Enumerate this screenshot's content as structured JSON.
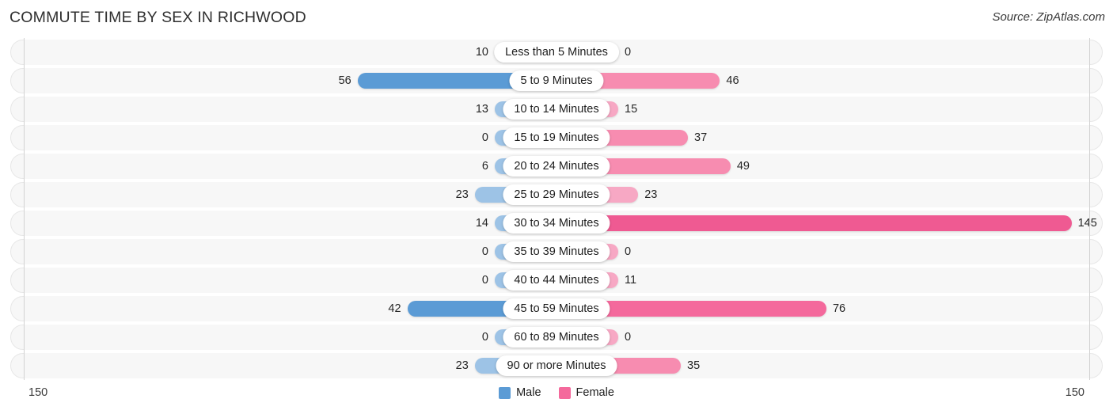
{
  "header": {
    "title": "COMMUTE TIME BY SEX IN RICHWOOD",
    "source": "Source: ZipAtlas.com"
  },
  "axis": {
    "left_tick": "150",
    "right_tick": "150"
  },
  "legend": {
    "items": [
      {
        "label": "Male",
        "color": "#5b9bd5"
      },
      {
        "label": "Female",
        "color": "#f4699c"
      }
    ]
  },
  "colors": {
    "male_light": "#9dc3e6",
    "male_dark": "#5b9bd5",
    "female_light": "#f7a8c4",
    "female_mid": "#f78cb0",
    "female_dark": "#f4699c",
    "female_max": "#ef5a92",
    "track": "#f7f7f7",
    "track_border": "#e7e7e7",
    "axis": "#d2d2d2"
  },
  "chart_data": {
    "type": "bar",
    "orientation": "horizontal",
    "layout": "diverging-pyramid",
    "title": "COMMUTE TIME BY SEX IN RICHWOOD",
    "xlabel": "",
    "ylabel": "",
    "xlim": [
      -150,
      150
    ],
    "axis_max": 150,
    "grid": false,
    "legend_position": "bottom-center",
    "categories": [
      "Less than 5 Minutes",
      "5 to 9 Minutes",
      "10 to 14 Minutes",
      "15 to 19 Minutes",
      "20 to 24 Minutes",
      "25 to 29 Minutes",
      "30 to 34 Minutes",
      "35 to 39 Minutes",
      "40 to 44 Minutes",
      "45 to 59 Minutes",
      "60 to 89 Minutes",
      "90 or more Minutes"
    ],
    "series": [
      {
        "name": "Male",
        "values": [
          10,
          56,
          13,
          0,
          6,
          23,
          14,
          0,
          0,
          42,
          0,
          23
        ]
      },
      {
        "name": "Female",
        "values": [
          0,
          46,
          15,
          37,
          49,
          23,
          145,
          0,
          11,
          76,
          0,
          35
        ]
      }
    ]
  },
  "rows": [
    {
      "label": "Less than 5 Minutes",
      "male": "10",
      "female": "0",
      "male_v": 10,
      "female_v": 0
    },
    {
      "label": "5 to 9 Minutes",
      "male": "56",
      "female": "46",
      "male_v": 56,
      "female_v": 46
    },
    {
      "label": "10 to 14 Minutes",
      "male": "13",
      "female": "15",
      "male_v": 13,
      "female_v": 15
    },
    {
      "label": "15 to 19 Minutes",
      "male": "0",
      "female": "37",
      "male_v": 0,
      "female_v": 37
    },
    {
      "label": "20 to 24 Minutes",
      "male": "6",
      "female": "49",
      "male_v": 6,
      "female_v": 49
    },
    {
      "label": "25 to 29 Minutes",
      "male": "23",
      "female": "23",
      "male_v": 23,
      "female_v": 23
    },
    {
      "label": "30 to 34 Minutes",
      "male": "14",
      "female": "145",
      "male_v": 14,
      "female_v": 145
    },
    {
      "label": "35 to 39 Minutes",
      "male": "0",
      "female": "0",
      "male_v": 0,
      "female_v": 0
    },
    {
      "label": "40 to 44 Minutes",
      "male": "0",
      "female": "11",
      "male_v": 0,
      "female_v": 11
    },
    {
      "label": "45 to 59 Minutes",
      "male": "42",
      "female": "76",
      "male_v": 42,
      "female_v": 76
    },
    {
      "label": "60 to 89 Minutes",
      "male": "0",
      "female": "0",
      "male_v": 0,
      "female_v": 0
    },
    {
      "label": "90 or more Minutes",
      "male": "23",
      "female": "35",
      "male_v": 23,
      "female_v": 35
    }
  ]
}
